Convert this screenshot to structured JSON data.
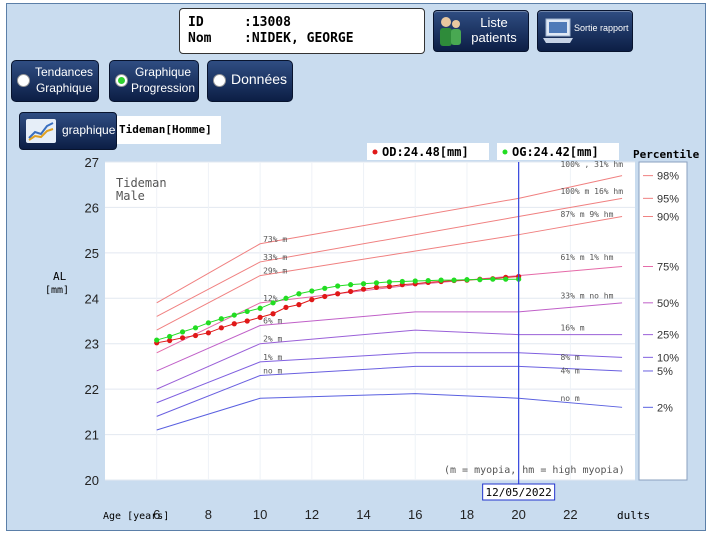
{
  "patient": {
    "id_label": "ID",
    "id_value": ":13008",
    "name_label": "Nom",
    "name_value": ":NIDEK, GEORGE"
  },
  "toolbar": {
    "liste_patients_line1": "Liste",
    "liste_patients_line2": "patients",
    "sortie_rapport": "Sortie rapport"
  },
  "tabs": [
    {
      "line1": "Tendances",
      "line2": "Graphique",
      "selected": false
    },
    {
      "line1": "Graphique",
      "line2": "Progression",
      "selected": true
    },
    {
      "line1": "Données",
      "line2": "",
      "selected": false
    }
  ],
  "graph_button": "graphique",
  "model": "Tideman[Homme]",
  "legend": {
    "od": "OD:24.48[mm]",
    "og": "OG:24.42[mm]",
    "od_color": "#e01818",
    "og_color": "#22dd22"
  },
  "chart_data": {
    "type": "line",
    "inner_title_line1": "Tideman",
    "inner_title_line2": "Male",
    "ylabel_line1": "AL",
    "ylabel_line2": "[mm]",
    "xlabel": "Age [years]",
    "ylim": [
      20,
      27
    ],
    "xlim": [
      4,
      24.5
    ],
    "y_ticks": [
      "27",
      "26",
      "25",
      "24",
      "23",
      "22",
      "21",
      "20"
    ],
    "x_ticks": [
      {
        "v": 6,
        "label": "6"
      },
      {
        "v": 8,
        "label": "8"
      },
      {
        "v": 10,
        "label": "10"
      },
      {
        "v": 12,
        "label": "12"
      },
      {
        "v": 14,
        "label": "14"
      },
      {
        "v": 16,
        "label": "16"
      },
      {
        "v": 18,
        "label": "18"
      },
      {
        "v": 20,
        "label": "20"
      },
      {
        "v": 22,
        "label": "22"
      }
    ],
    "x_tick_adults": "dults",
    "current_age": 20,
    "current_date_label": "12/05/2022",
    "footnote": "(m = myopia,   hm = high myopia)",
    "percentile_title": "Percentile",
    "percentile_curves": [
      {
        "label": "98%",
        "color": "#f08080",
        "points": [
          [
            6,
            23.9
          ],
          [
            10,
            25.2
          ],
          [
            20,
            26.2
          ],
          [
            24,
            26.7
          ]
        ]
      },
      {
        "label": "95%",
        "color": "#f08080",
        "points": [
          [
            6,
            23.6
          ],
          [
            10,
            24.8
          ],
          [
            20,
            25.8
          ],
          [
            24,
            26.2
          ]
        ]
      },
      {
        "label": "90%",
        "color": "#f08080",
        "points": [
          [
            6,
            23.3
          ],
          [
            10,
            24.5
          ],
          [
            20,
            25.4
          ],
          [
            24,
            25.8
          ]
        ]
      },
      {
        "label": "75%",
        "color": "#e56aa8",
        "points": [
          [
            6,
            22.8
          ],
          [
            10,
            23.9
          ],
          [
            16,
            24.3
          ],
          [
            20,
            24.5
          ],
          [
            24,
            24.7
          ]
        ]
      },
      {
        "label": "50%",
        "color": "#c060c8",
        "points": [
          [
            6,
            22.4
          ],
          [
            10,
            23.4
          ],
          [
            16,
            23.7
          ],
          [
            20,
            23.7
          ],
          [
            24,
            23.9
          ]
        ]
      },
      {
        "label": "25%",
        "color": "#9a60d8",
        "points": [
          [
            6,
            22.0
          ],
          [
            10,
            23.0
          ],
          [
            16,
            23.3
          ],
          [
            20,
            23.2
          ],
          [
            24,
            23.2
          ]
        ]
      },
      {
        "label": "10%",
        "color": "#8060e0",
        "points": [
          [
            6,
            21.7
          ],
          [
            10,
            22.6
          ],
          [
            16,
            22.8
          ],
          [
            20,
            22.8
          ],
          [
            24,
            22.7
          ]
        ]
      },
      {
        "label": "5%",
        "color": "#6a60e0",
        "points": [
          [
            6,
            21.4
          ],
          [
            10,
            22.3
          ],
          [
            16,
            22.5
          ],
          [
            20,
            22.5
          ],
          [
            24,
            22.4
          ]
        ]
      },
      {
        "label": "2%",
        "color": "#5a60e0",
        "points": [
          [
            6,
            21.1
          ],
          [
            10,
            21.8
          ],
          [
            16,
            21.9
          ],
          [
            20,
            21.8
          ],
          [
            24,
            21.6
          ]
        ]
      }
    ],
    "curve_annotations": [
      {
        "text": "73% m",
        "x": 10,
        "y": 25.2
      },
      {
        "text": "33% m",
        "x": 10,
        "y": 24.8
      },
      {
        "text": "29% m",
        "x": 10,
        "y": 24.5
      },
      {
        "text": "12%",
        "x": 10,
        "y": 23.9
      },
      {
        "text": "6% m",
        "x": 10,
        "y": 23.4
      },
      {
        "text": "2% m",
        "x": 10,
        "y": 23.0
      },
      {
        "text": "1% m",
        "x": 10,
        "y": 22.6
      },
      {
        "text": "no m",
        "x": 10,
        "y": 22.3
      },
      {
        "text": "100% ,  31% hm",
        "x": 21.5,
        "y": 26.85
      },
      {
        "text": "100% m  16% hm",
        "x": 21.5,
        "y": 26.25
      },
      {
        "text": "87% m   9% hm",
        "x": 21.5,
        "y": 25.75
      },
      {
        "text": "61% m   1% hm",
        "x": 21.5,
        "y": 24.8
      },
      {
        "text": "33% m  no hm",
        "x": 21.5,
        "y": 23.95
      },
      {
        "text": "16% m",
        "x": 21.5,
        "y": 23.25
      },
      {
        "text": "8% m",
        "x": 21.5,
        "y": 22.6
      },
      {
        "text": "4% m",
        "x": 21.5,
        "y": 22.3
      },
      {
        "text": "no m",
        "x": 21.5,
        "y": 21.7
      }
    ],
    "series": [
      {
        "name": "OD",
        "color": "#e01818",
        "points": [
          [
            6,
            23.02
          ],
          [
            6.5,
            23.07
          ],
          [
            7,
            23.13
          ],
          [
            7.5,
            23.18
          ],
          [
            8,
            23.24
          ],
          [
            8.5,
            23.35
          ],
          [
            9,
            23.44
          ],
          [
            9.5,
            23.5
          ],
          [
            10,
            23.58
          ],
          [
            10.5,
            23.66
          ],
          [
            11,
            23.8
          ],
          [
            11.5,
            23.86
          ],
          [
            12,
            23.97
          ],
          [
            12.5,
            24.04
          ],
          [
            13,
            24.1
          ],
          [
            13.5,
            24.15
          ],
          [
            14,
            24.2
          ],
          [
            14.5,
            24.24
          ],
          [
            15,
            24.26
          ],
          [
            15.5,
            24.3
          ],
          [
            16,
            24.32
          ],
          [
            16.5,
            24.35
          ],
          [
            17,
            24.37
          ],
          [
            17.5,
            24.39
          ],
          [
            18,
            24.4
          ],
          [
            18.5,
            24.42
          ],
          [
            19,
            24.43
          ],
          [
            19.5,
            24.46
          ],
          [
            20,
            24.48
          ]
        ]
      },
      {
        "name": "OG",
        "color": "#22dd22",
        "points": [
          [
            6,
            23.08
          ],
          [
            6.5,
            23.16
          ],
          [
            7,
            23.26
          ],
          [
            7.5,
            23.35
          ],
          [
            8,
            23.46
          ],
          [
            8.5,
            23.55
          ],
          [
            9,
            23.63
          ],
          [
            9.5,
            23.71
          ],
          [
            10,
            23.78
          ],
          [
            10.5,
            23.9
          ],
          [
            11,
            24.0
          ],
          [
            11.5,
            24.1
          ],
          [
            12,
            24.16
          ],
          [
            12.5,
            24.22
          ],
          [
            13,
            24.27
          ],
          [
            13.5,
            24.3
          ],
          [
            14,
            24.32
          ],
          [
            14.5,
            24.34
          ],
          [
            15,
            24.36
          ],
          [
            15.5,
            24.37
          ],
          [
            16,
            24.38
          ],
          [
            16.5,
            24.39
          ],
          [
            17,
            24.4
          ],
          [
            17.5,
            24.4
          ],
          [
            18,
            24.41
          ],
          [
            18.5,
            24.41
          ],
          [
            19,
            24.42
          ],
          [
            19.5,
            24.42
          ],
          [
            20,
            24.42
          ]
        ]
      }
    ]
  }
}
